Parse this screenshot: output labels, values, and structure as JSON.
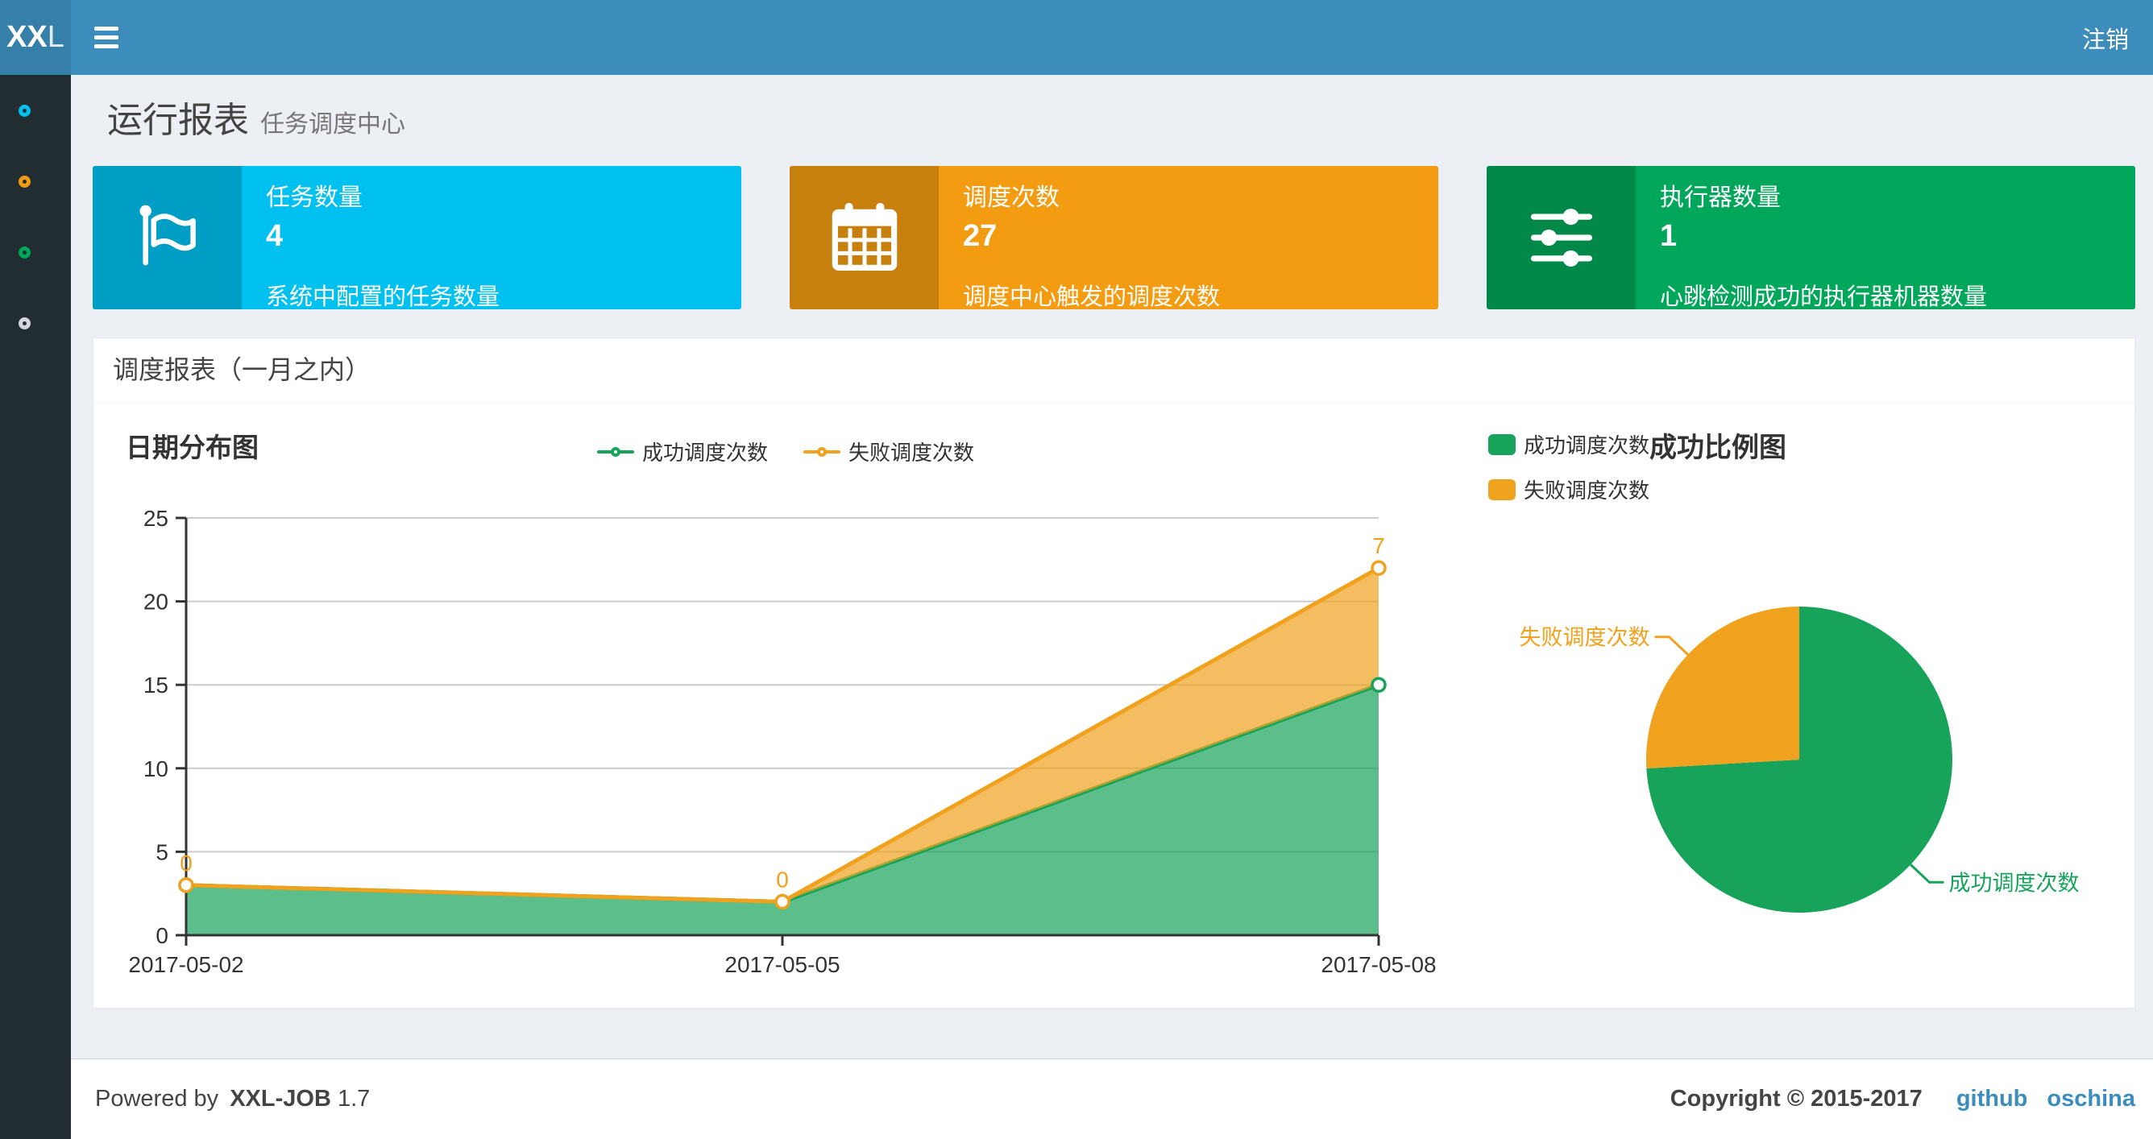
{
  "navbar": {
    "logo_bold": "XX",
    "logo_light": "L",
    "logout_label": "注销"
  },
  "sidebar": {
    "items": [
      {
        "icon": "circle-outline-icon",
        "color": "#00c0ef"
      },
      {
        "icon": "circle-outline-icon",
        "color": "#f39c12"
      },
      {
        "icon": "circle-outline-icon",
        "color": "#00a65a"
      },
      {
        "icon": "circle-outline-icon",
        "color": "#d2d6de"
      }
    ]
  },
  "page_header": {
    "title": "运行报表",
    "subtitle": "任务调度中心"
  },
  "stat_boxes": [
    {
      "label": "任务数量",
      "value": "4",
      "description": "系统中配置的任务数量",
      "color": "#00c0ef",
      "icon": "flag-icon"
    },
    {
      "label": "调度次数",
      "value": "27",
      "description": "调度中心触发的调度次数",
      "color": "#f39c12",
      "icon": "calendar-icon"
    },
    {
      "label": "执行器数量",
      "value": "1",
      "description": "心跳检测成功的执行器机器数量",
      "color": "#00a65a",
      "icon": "sliders-icon"
    }
  ],
  "panel": {
    "title": "调度报表（一月之内）"
  },
  "chart_data": [
    {
      "type": "area",
      "title": "日期分布图",
      "x": [
        "2017-05-02",
        "2017-05-05",
        "2017-05-08"
      ],
      "series": [
        {
          "name": "成功调度次数",
          "color": "#17a35a",
          "values": [
            3,
            2,
            15
          ],
          "show_labels": false
        },
        {
          "name": "失败调度次数",
          "color": "#f0a11e",
          "values": [
            0,
            0,
            7
          ],
          "show_labels": true
        }
      ],
      "stacked": true,
      "ylim": [
        0,
        25
      ],
      "yticks": [
        0,
        5,
        10,
        15,
        20,
        25
      ],
      "grid": true,
      "legend_position": "top"
    },
    {
      "type": "pie",
      "title": "成功比例图",
      "slices": [
        {
          "name": "成功调度次数",
          "value": 20,
          "color": "#17a35a"
        },
        {
          "name": "失败调度次数",
          "value": 7,
          "color": "#f0a11e"
        }
      ],
      "legend_position": "left"
    }
  ],
  "footer": {
    "powered_prefix": "Powered by",
    "brand": "XXL-JOB",
    "version": "1.7",
    "copyright": "Copyright © 2015-2017",
    "links": [
      {
        "label": "github"
      },
      {
        "label": "oschina"
      }
    ]
  }
}
